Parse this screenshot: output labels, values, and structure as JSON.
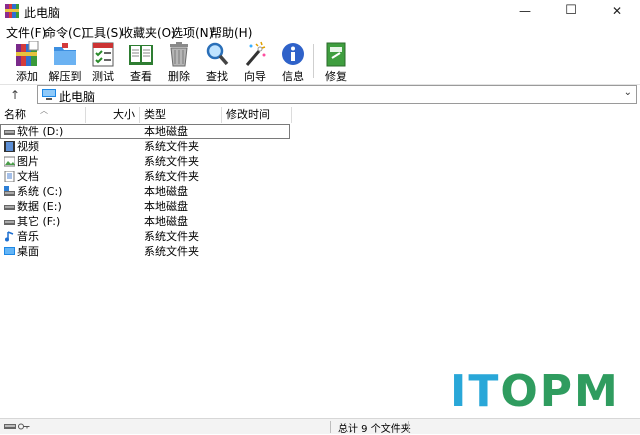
{
  "window": {
    "title": "此电脑",
    "minimize": "—",
    "maximize": "☐",
    "close": "✕"
  },
  "menu": [
    "文件(F)",
    "命令(C)",
    "工具(S)",
    "收藏夹(O)",
    "选项(N)",
    "帮助(H)"
  ],
  "toolbar": [
    {
      "label": "添加",
      "icon": "books-stack-icon"
    },
    {
      "label": "解压到",
      "icon": "folder-extract-icon"
    },
    {
      "label": "测试",
      "icon": "checklist-icon"
    },
    {
      "label": "查看",
      "icon": "open-book-icon"
    },
    {
      "label": "删除",
      "icon": "trash-can-icon"
    },
    {
      "label": "查找",
      "icon": "magnifier-icon"
    },
    {
      "label": "向导",
      "icon": "magic-wand-icon"
    },
    {
      "label": "信息",
      "icon": "info-icon"
    },
    {
      "label": "修复",
      "icon": "repair-kit-icon"
    }
  ],
  "address": {
    "up": "↑",
    "path": "此电脑",
    "dropdown": "⌄"
  },
  "columns": {
    "name": "名称",
    "size": "大小",
    "type": "类型",
    "modified": "修改时间"
  },
  "files": [
    {
      "name": "软件 (D:)",
      "size": "",
      "type": "本地磁盘",
      "icon": "drive-icon",
      "selected": true
    },
    {
      "name": "视频",
      "size": "",
      "type": "系统文件夹",
      "icon": "video-folder-icon"
    },
    {
      "name": "图片",
      "size": "",
      "type": "系统文件夹",
      "icon": "pictures-folder-icon"
    },
    {
      "name": "文档",
      "size": "",
      "type": "系统文件夹",
      "icon": "documents-folder-icon"
    },
    {
      "name": "系统 (C:)",
      "size": "",
      "type": "本地磁盘",
      "icon": "system-drive-icon"
    },
    {
      "name": "数据 (E:)",
      "size": "",
      "type": "本地磁盘",
      "icon": "drive-icon"
    },
    {
      "name": "其它 (F:)",
      "size": "",
      "type": "本地磁盘",
      "icon": "drive-icon"
    },
    {
      "name": "音乐",
      "size": "",
      "type": "系统文件夹",
      "icon": "music-folder-icon"
    },
    {
      "name": "桌面",
      "size": "",
      "type": "系统文件夹",
      "icon": "desktop-folder-icon"
    }
  ],
  "status": {
    "text": "总计 9 个文件夹"
  },
  "watermark": {
    "part1": "IT",
    "part2": "OPM"
  },
  "colors": {
    "watermark_blue": "#29a7d8",
    "watermark_green": "#2f9c5f"
  }
}
